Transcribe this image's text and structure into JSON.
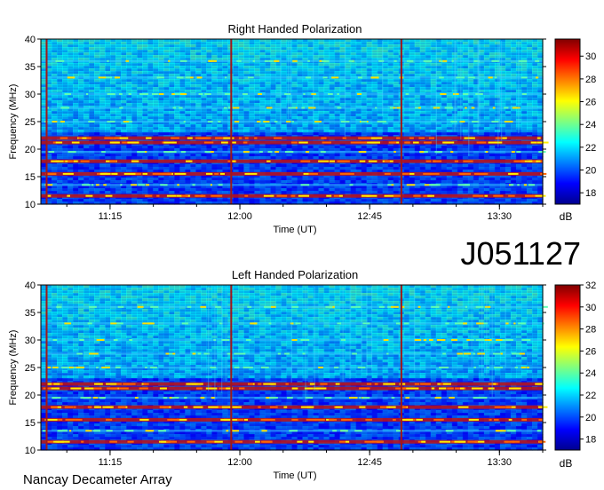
{
  "figure_id": "J051127",
  "footer": "Nancay Decameter Array",
  "chart_data": [
    {
      "type": "heatmap",
      "title": "Right Handed Polarization",
      "xlabel": "Time (UT)",
      "ylabel": "Frequency (MHz)",
      "xlim": [
        "10:51",
        "13:45"
      ],
      "ylim": [
        10,
        40
      ],
      "x_ticks": [
        "11:15",
        "12:00",
        "12:45",
        "13:30"
      ],
      "y_ticks": [
        10,
        15,
        20,
        25,
        30,
        35,
        40
      ],
      "colorbar": {
        "label": "dB",
        "ticks": [
          18,
          20,
          22,
          24,
          26,
          28,
          30
        ],
        "range": [
          17,
          31.5
        ]
      },
      "bands_mhz": [
        11.5,
        13.5,
        15.5,
        17.8,
        19.5,
        21.2,
        22.0,
        25.0,
        27.5,
        30.0,
        33.0,
        36.0
      ],
      "vertical_events_ut": [
        "10:53",
        "11:57",
        "12:56"
      ]
    },
    {
      "type": "heatmap",
      "title": "Left Handed Polarization",
      "xlabel": "Time (UT)",
      "ylabel": "Frequency (MHz)",
      "xlim": [
        "10:51",
        "13:45"
      ],
      "ylim": [
        10,
        40
      ],
      "x_ticks": [
        "11:15",
        "12:00",
        "12:45",
        "13:30"
      ],
      "y_ticks": [
        10,
        15,
        20,
        25,
        30,
        35,
        40
      ],
      "colorbar": {
        "label": "dB",
        "ticks": [
          18,
          20,
          22,
          24,
          26,
          28,
          30,
          32
        ],
        "range": [
          17,
          32
        ]
      },
      "bands_mhz": [
        11.5,
        13.5,
        15.5,
        17.8,
        19.5,
        21.2,
        22.0,
        25.0,
        27.5,
        30.0,
        33.0,
        36.0
      ],
      "vertical_events_ut": [
        "10:53",
        "11:57",
        "12:56"
      ]
    }
  ]
}
